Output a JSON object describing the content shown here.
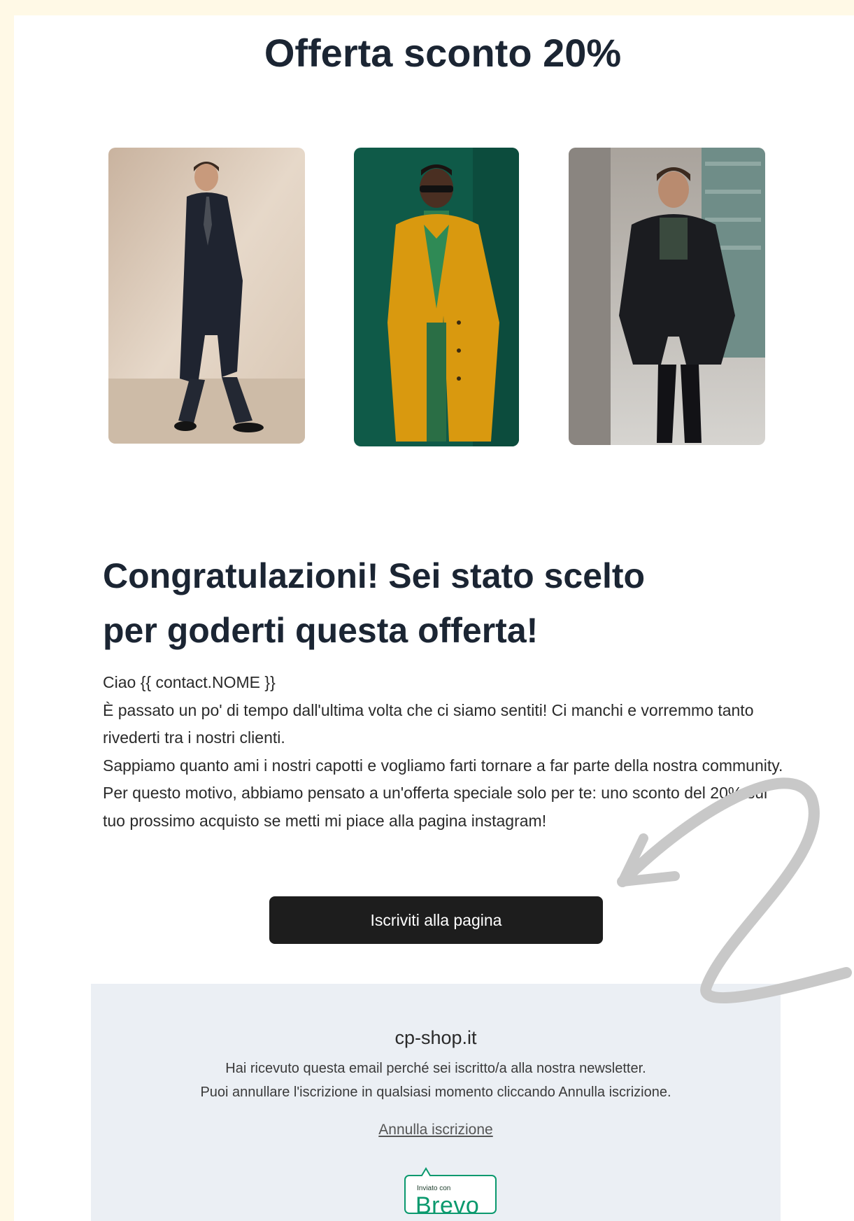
{
  "email": {
    "headline": "Offerta sconto 20%",
    "photos": [
      {
        "alt": "Uomo in cappotto lungo nero"
      },
      {
        "alt": "Uomo in cappotto giallo su sfondo verde"
      },
      {
        "alt": "Uomo in cappotto nero in città"
      }
    ],
    "title_line1": "Congratulazioni! Sei stato scelto",
    "title_line2": "per goderti questa offerta!",
    "greeting": "Ciao {{ contact.NOME }}",
    "paragraph1": "È passato un po' di tempo dall'ultima volta che ci siamo sentiti! Ci manchi e vorremmo tanto rivederti tra i nostri clienti.",
    "paragraph2": "Sappiamo quanto ami i nostri capotti e vogliamo farti tornare a far parte della nostra community. Per questo motivo, abbiamo pensato a un'offerta speciale solo per te: uno sconto del 20% sul tuo prossimo acquisto se metti mi piace alla pagina instagram!",
    "cta_label": "Iscriviti alla pagina"
  },
  "footer": {
    "site": "cp-shop.it",
    "note_line1": "Hai ricevuto questa email perché sei iscritto/a alla nostra newsletter.",
    "note_line2": "Puoi annullare l'iscrizione in qualsiasi momento cliccando Annulla iscrizione.",
    "unsubscribe": "Annulla iscrizione",
    "badge_small": "Inviato con",
    "badge_logo": "Brevo"
  },
  "colors": {
    "page_background": "#fff9e6",
    "text_dark": "#1b2533",
    "button": "#1d1d1d",
    "footer_background": "#ebeff4",
    "brevo_green": "#0b996e"
  }
}
